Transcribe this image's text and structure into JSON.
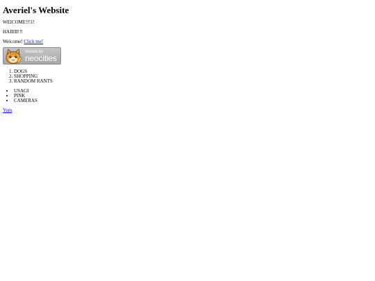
{
  "header": {
    "title": "Averiel's Website"
  },
  "intro": {
    "line1": "WElCOME!!!1!",
    "line2": "HAIIIII!!!",
    "welcome_text": "Welcome! ",
    "click_link": "Click me!"
  },
  "badge": {
    "hosted_label": "hosted by",
    "brand_label": "neocities",
    "icon": "neocities-cat-logo"
  },
  "ordered_list": [
    "DOGS",
    "SHOPPING",
    "RANDOM RANTS"
  ],
  "unordered_list": [
    "USAGI",
    "PINK",
    "CAMERAS"
  ],
  "footer": {
    "link_text": "Yum"
  },
  "colors": {
    "link": "#0000ee",
    "badge_bg": "#b3b3b3",
    "cat_orange": "#f2a23a"
  }
}
